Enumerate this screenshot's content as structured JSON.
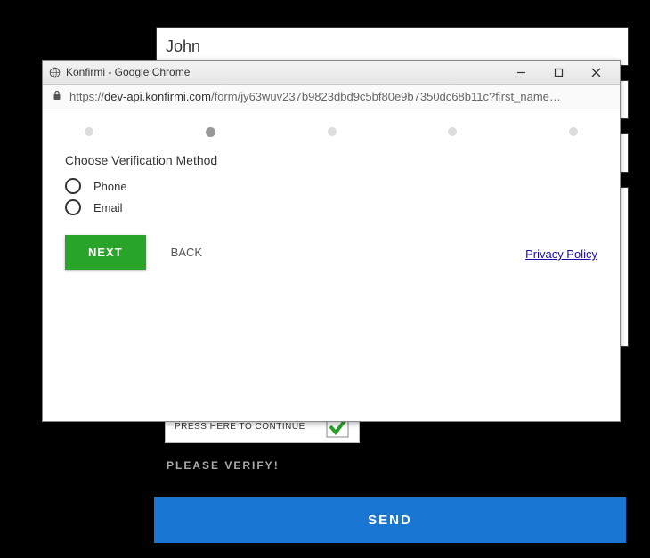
{
  "background": {
    "first_name": "John",
    "continue_text": "PRESS HERE TO CONTINUE",
    "verify_text": "PLEASE VERIFY!",
    "send_label": "SEND"
  },
  "popup": {
    "window_title": "Konfirmi - Google Chrome",
    "url_prefix": "https://",
    "url_host": "dev-api.konfirmi.com",
    "url_path": "/form/jy63wuv237b9823dbd9c5bf80e9b7350dc68b11c?first_name…",
    "stepper": {
      "total": 5,
      "active_index": 1
    },
    "heading": "Choose Verification Method",
    "options": [
      {
        "label": "Phone"
      },
      {
        "label": "Email"
      }
    ],
    "next_label": "NEXT",
    "back_label": "BACK",
    "privacy_label": "Privacy Policy"
  }
}
